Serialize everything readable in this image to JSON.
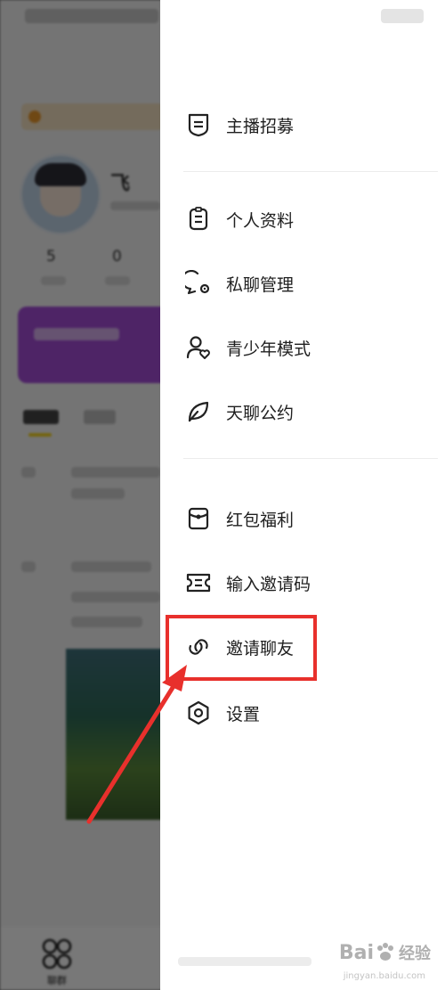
{
  "background": {
    "nickname_initial": "飞",
    "stats": [
      "5",
      "0"
    ],
    "bottom_nav_label": "聊群"
  },
  "drawer": {
    "items_group1": [
      {
        "label": "主播招募",
        "icon": "recruit-shield-icon"
      }
    ],
    "items_group2": [
      {
        "label": "个人资料",
        "icon": "document-icon"
      },
      {
        "label": "私聊管理",
        "icon": "chat-settings-icon"
      },
      {
        "label": "青少年模式",
        "icon": "teen-mode-icon"
      },
      {
        "label": "天聊公约",
        "icon": "leaf-icon"
      }
    ],
    "items_group3": [
      {
        "label": "红包福利",
        "icon": "red-envelope-icon"
      },
      {
        "label": "输入邀请码",
        "icon": "ticket-icon"
      },
      {
        "label": "邀请聊友",
        "icon": "link-icon"
      },
      {
        "label": "设置",
        "icon": "settings-hexagon-icon"
      }
    ]
  },
  "annotation": {
    "highlight_color": "#e8302c",
    "highlighted_item": "邀请聊友"
  },
  "watermark": {
    "text": "Bai",
    "suffix": "经验",
    "sub": "jingyan.baidu.com"
  }
}
